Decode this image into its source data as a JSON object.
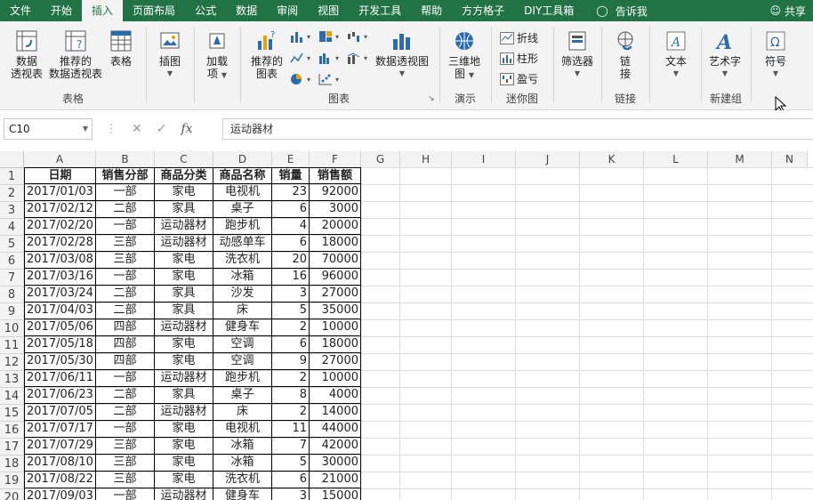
{
  "tabs": [
    "文件",
    "开始",
    "插入",
    "页面布局",
    "公式",
    "数据",
    "审阅",
    "视图",
    "开发工具",
    "帮助",
    "方方格子",
    "DIY工具箱"
  ],
  "active_tab": "插入",
  "tell_me": "告诉我",
  "share": "共享",
  "ribbon": {
    "pivot_table": [
      "数据",
      "透视表"
    ],
    "recommended_pivot": [
      "推荐的",
      "数据透视表"
    ],
    "table": "表格",
    "group_tables": "表格",
    "illustrations": "插图",
    "addins": [
      "加载",
      "项"
    ],
    "recommended_charts": [
      "推荐的",
      "图表"
    ],
    "pivot_chart": "数据透视图",
    "group_charts": "图表",
    "map3d": [
      "三维地",
      "图"
    ],
    "group_tours": "演示",
    "spark_line": "折线",
    "spark_column": "柱形",
    "spark_winloss": "盈亏",
    "group_sparklines": "迷你图",
    "slicer": "筛选器",
    "link": [
      "链",
      "接"
    ],
    "group_links": "链接",
    "text": "文本",
    "wordart": "艺术字",
    "group_new": "新建组",
    "symbol": "符号"
  },
  "name_box": "C10",
  "formula_value": "运动器材",
  "columns": [
    "A",
    "B",
    "C",
    "D",
    "E",
    "F",
    "G",
    "H",
    "I",
    "J",
    "K",
    "L",
    "M",
    "N"
  ],
  "rows": [
    "1",
    "2",
    "3",
    "4",
    "5",
    "6",
    "7",
    "8",
    "9",
    "10",
    "11",
    "12",
    "13",
    "14",
    "15",
    "16",
    "17",
    "18",
    "19",
    "20"
  ],
  "table": {
    "headers": [
      "日期",
      "销售分部",
      "商品分类",
      "商品名称",
      "销量",
      "销售额"
    ],
    "rows": [
      [
        "2017/01/03",
        "一部",
        "家电",
        "电视机",
        "23",
        "92000"
      ],
      [
        "2017/02/12",
        "二部",
        "家具",
        "桌子",
        "6",
        "3000"
      ],
      [
        "2017/02/20",
        "一部",
        "运动器材",
        "跑步机",
        "4",
        "20000"
      ],
      [
        "2017/02/28",
        "三部",
        "运动器材",
        "动感单车",
        "6",
        "18000"
      ],
      [
        "2017/03/08",
        "三部",
        "家电",
        "洗衣机",
        "20",
        "70000"
      ],
      [
        "2017/03/16",
        "一部",
        "家电",
        "冰箱",
        "16",
        "96000"
      ],
      [
        "2017/03/24",
        "二部",
        "家具",
        "沙发",
        "3",
        "27000"
      ],
      [
        "2017/04/03",
        "二部",
        "家具",
        "床",
        "5",
        "35000"
      ],
      [
        "2017/05/06",
        "四部",
        "运动器材",
        "健身车",
        "2",
        "10000"
      ],
      [
        "2017/05/18",
        "四部",
        "家电",
        "空调",
        "6",
        "18000"
      ],
      [
        "2017/05/30",
        "四部",
        "家电",
        "空调",
        "9",
        "27000"
      ],
      [
        "2017/06/11",
        "一部",
        "运动器材",
        "跑步机",
        "2",
        "10000"
      ],
      [
        "2017/06/23",
        "二部",
        "家具",
        "桌子",
        "8",
        "4000"
      ],
      [
        "2017/07/05",
        "二部",
        "运动器材",
        "床",
        "2",
        "14000"
      ],
      [
        "2017/07/17",
        "一部",
        "家电",
        "电视机",
        "11",
        "44000"
      ],
      [
        "2017/07/29",
        "三部",
        "家电",
        "冰箱",
        "7",
        "42000"
      ],
      [
        "2017/08/10",
        "三部",
        "家电",
        "冰箱",
        "5",
        "30000"
      ],
      [
        "2017/08/22",
        "三部",
        "家电",
        "洗衣机",
        "6",
        "21000"
      ],
      [
        "2017/09/03",
        "一部",
        "运动器材",
        "健身车",
        "3",
        "15000"
      ]
    ]
  }
}
